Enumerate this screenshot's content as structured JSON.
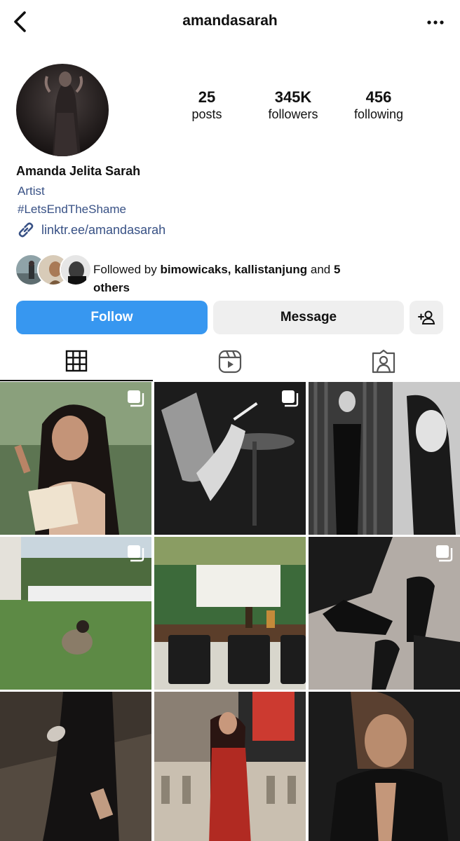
{
  "header": {
    "username": "amandasarah"
  },
  "stats": [
    {
      "value": "25",
      "label": "posts"
    },
    {
      "value": "345K",
      "label": "followers"
    },
    {
      "value": "456",
      "label": "following"
    }
  ],
  "profile": {
    "full_name": "Amanda Jelita Sarah",
    "category": "Artist",
    "bio_hashtag": "#LetsEndTheShame",
    "link": "linktr.ee/amandasarah"
  },
  "followed_by": {
    "prefix": "Followed by ",
    "names": "bimowicaks, kallistanjung",
    "and_text": " and ",
    "others_count": "5",
    "others_label": "others"
  },
  "actions": {
    "follow_label": "Follow",
    "message_label": "Message"
  },
  "tabs": [
    {
      "name": "posts-grid",
      "icon": "grid-icon"
    },
    {
      "name": "reels",
      "icon": "reels-icon"
    },
    {
      "name": "tagged",
      "icon": "tagged-user-icon"
    }
  ],
  "posts": [
    {
      "type": "carousel"
    },
    {
      "type": "carousel"
    },
    {
      "type": "single"
    },
    {
      "type": "carousel"
    },
    {
      "type": "single"
    },
    {
      "type": "carousel"
    },
    {
      "type": "single"
    },
    {
      "type": "single"
    },
    {
      "type": "single"
    }
  ],
  "colors": {
    "accent": "#3797f0",
    "link": "#385185",
    "button_gray": "#efefef"
  }
}
